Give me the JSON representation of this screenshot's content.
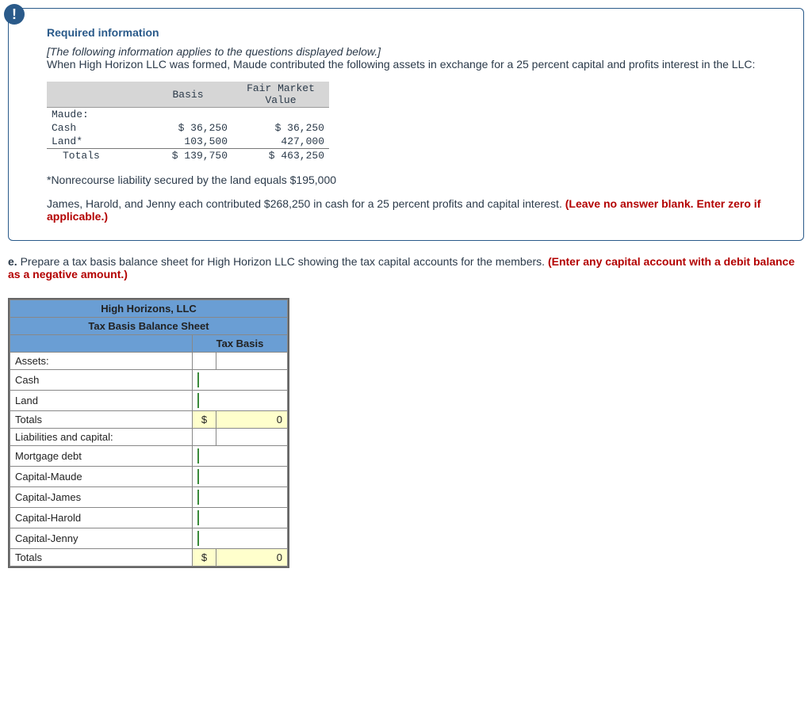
{
  "alert_icon": "!",
  "info": {
    "title": "Required information",
    "hint": "[The following information applies to the questions displayed below.]",
    "intro": "When High Horizon LLC was formed, Maude contributed the following assets in exchange for a 25 percent capital and profits interest in the LLC:",
    "table": {
      "col1": "Basis",
      "col2_l1": "Fair Market",
      "col2_l2": "Value",
      "row_owner": "Maude:",
      "rows": [
        {
          "label": "Cash",
          "basis": "$ 36,250",
          "fmv": "$ 36,250"
        },
        {
          "label": "Land*",
          "basis": "103,500",
          "fmv": "427,000"
        }
      ],
      "totals_label": "Totals",
      "totals_basis": "$ 139,750",
      "totals_fmv": "$ 463,250"
    },
    "footnote": "*Nonrecourse liability secured by the land equals $195,000",
    "para2_plain": "James, Harold, and Jenny each contributed $268,250 in cash for a 25 percent profits and capital interest. ",
    "para2_red": "(Leave no answer blank. Enter zero if applicable.)"
  },
  "question": {
    "label": "e.",
    "text": " Prepare a tax basis balance sheet for High Horizon LLC showing the tax capital accounts for the members. ",
    "red": "(Enter any capital account with a debit balance as a negative amount.)"
  },
  "balance_sheet": {
    "title": "High Horizons, LLC",
    "subtitle": "Tax Basis Balance Sheet",
    "col_head": "Tax Basis",
    "section1": "Assets:",
    "rows1": [
      "Cash",
      "Land"
    ],
    "totals_label": "Totals",
    "section2": "Liabilities and capital:",
    "rows2": [
      "Mortgage debt",
      "Capital-Maude",
      "Capital-James",
      "Capital-Harold",
      "Capital-Jenny"
    ],
    "dollar": "$",
    "zero": "0"
  }
}
